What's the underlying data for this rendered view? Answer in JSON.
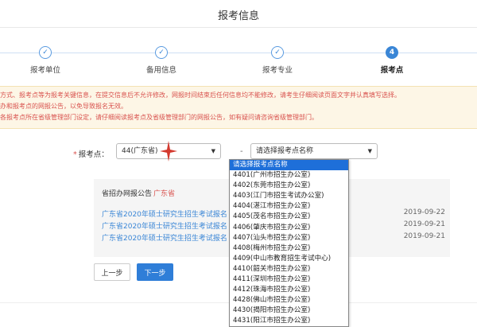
{
  "page": {
    "title": "报考信息"
  },
  "steps": [
    {
      "label": "报考单位",
      "mark": "✓",
      "active": false
    },
    {
      "label": "备用信息",
      "mark": "✓",
      "active": false
    },
    {
      "label": "报考专业",
      "mark": "✓",
      "active": false
    },
    {
      "label": "报考点",
      "mark": "4",
      "active": true
    }
  ],
  "notice": {
    "lines": [
      "方式、报考点等为报考关键信息，在提交信息后不允许修改，网报时间结束后任何信息均不能修改，请考生仔细阅读页面文字并认真填写选择。",
      "办和报考点的网报公告，以免导致报名无效。",
      "各报考点所在省级管理部门设定，请仔细阅读报考点及省级管理部门的网报公告，如有疑问请咨询省级管理部门。"
    ]
  },
  "form": {
    "required_mark": "*",
    "label": "报考点：",
    "province_value": "44(广东省)",
    "caret": "▼",
    "dash": "-",
    "site_value": "请选择报考点名称"
  },
  "announcements": {
    "title": "省招办网报公告",
    "province": "广东省",
    "items": [
      {
        "text": "广东省2020年硕士研究生招生考试报名",
        "date": "2019-09-22"
      },
      {
        "text": "广东省2020年硕士研究生招生考试报名",
        "date": "2019-09-21"
      },
      {
        "text": "广东省2020年硕士研究生招生考试报名",
        "date": "2019-09-21"
      }
    ]
  },
  "buttons": {
    "prev": "上一步",
    "next": "下一步"
  },
  "dropdown": {
    "options": [
      "请选择报考点名称",
      "4401(广州市招生办公室)",
      "4402(东莞市招生办公室)",
      "4403(江门市招生考试办公室)",
      "4404(湛江市招生办公室)",
      "4405(茂名市招生办公室)",
      "4406(肇庆市招生办公室)",
      "4407(汕头市招生办公室)",
      "4408(梅州市招生办公室)",
      "4409(中山市教育招生考试中心)",
      "4410(韶关市招生办公室)",
      "4411(深圳市招生办公室)",
      "4412(珠海市招生办公室)",
      "4428(佛山市招生办公室)",
      "4430(揭阳市招生办公室)",
      "4431(阳江市招生办公室)"
    ]
  },
  "colors": {
    "accent": "#3a86d6",
    "warning": "#d9534f",
    "notice_bg": "#fdf6e6",
    "star": "#d43a2f"
  }
}
